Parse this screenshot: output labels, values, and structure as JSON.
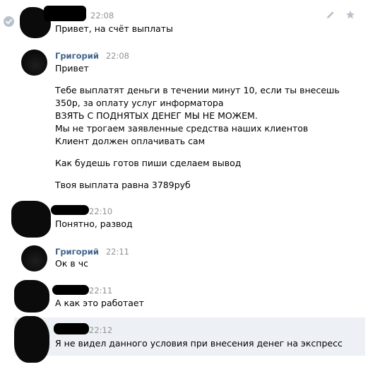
{
  "messages": [
    {
      "author": "",
      "time": "22:08",
      "lines": [
        "Привет, на счёт выплаты"
      ]
    },
    {
      "author": "Григорий",
      "time": "22:08",
      "lines": [
        "Привет",
        "",
        "Тебе выплатят деньги в течении минут 10, если ты внесешь",
        "350р, за оплату услуг информатора",
        "ВЗЯТЬ С ПОДНЯТЫХ ДЕНЕГ МЫ НЕ МОЖЕМ.",
        "Мы не трогаем заявленные средства наших клиентов",
        "Клиент должен оплачивать сам",
        "",
        "Как будешь готов пиши сделаем вывод",
        "",
        "Твоя выплата равна 3789руб"
      ]
    },
    {
      "author": "",
      "time": "22:10",
      "lines": [
        "Понятно, развод"
      ]
    },
    {
      "author": "Григорий",
      "time": "22:11",
      "lines": [
        "Ок в чс"
      ]
    },
    {
      "author": "",
      "time": "22:11",
      "lines": [
        "А как это работает"
      ]
    },
    {
      "author": "",
      "time": "22:12",
      "lines": [
        "Я не видел данного условия при внесения денег на экспресс"
      ]
    }
  ],
  "icons": {
    "selected": "check-circle-icon",
    "edit": "pencil-icon",
    "favorite": "star-icon"
  },
  "colors": {
    "author_link": "#42648b",
    "timestamp": "#939393",
    "highlight_row": "#edf0f5",
    "check_badge": "#b9c2cc",
    "toolbar_icon": "#b9c2cc"
  }
}
